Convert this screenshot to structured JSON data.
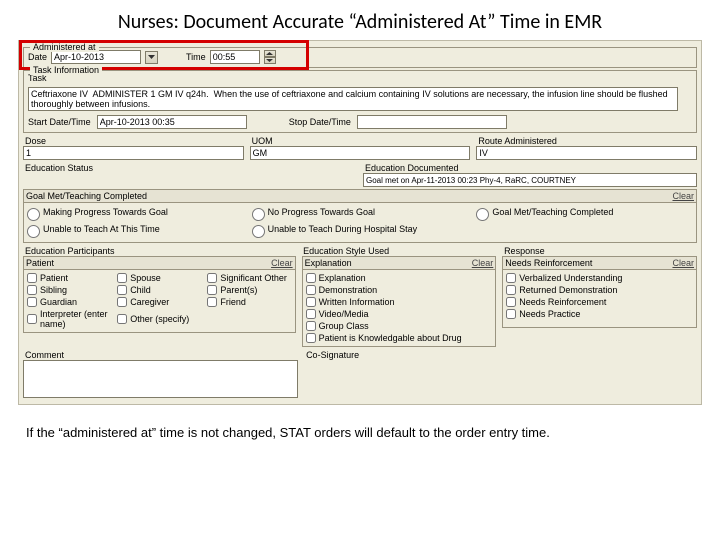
{
  "title": "Nurses: Document Accurate “Administered At” Time in EMR",
  "administered": {
    "section": "Administered at",
    "dateLabel": "Date",
    "dateValue": "Apr-10-2013",
    "timeLabel": "Time",
    "timeValue": "00:55"
  },
  "task": {
    "section": "Task Information",
    "label": "Task",
    "value": "Ceftriaxone IV  ADMINISTER 1 GM IV q24h.  When the use of ceftriaxone and calcium containing IV solutions are necessary, the infusion line should be flushed thoroughly between infusions.",
    "startLabel": "Start Date/Time",
    "startValue": "Apr-10-2013 00:35",
    "stopLabel": "Stop Date/Time",
    "stopValue": ""
  },
  "dose": {
    "label": "Dose",
    "value": "1"
  },
  "uom": {
    "label": "UOM",
    "value": "GM"
  },
  "route": {
    "label": "Route Administered",
    "value": "IV"
  },
  "eduStatus": {
    "label": "Education Status"
  },
  "eduDoc": {
    "label": "Education Documented",
    "value": "Goal met on Apr-11-2013 00:23 Phy-4, RaRC, COURTNEY"
  },
  "goalMet": {
    "header": "Goal Met/Teaching Completed",
    "clear": "Clear",
    "opts": [
      "Making Progress Towards Goal",
      "No Progress Towards Goal",
      "Goal Met/Teaching Completed",
      "Unable to Teach At This Time",
      "Unable to Teach During Hospital Stay"
    ]
  },
  "participants": {
    "label": "Education Participants",
    "header": "Patient",
    "clear": "Clear",
    "items": [
      "Patient",
      "Spouse",
      "Significant Other",
      "Sibling",
      "Child",
      "Parent(s)",
      "Guardian",
      "Caregiver",
      "Friend",
      "Interpreter (enter name)",
      "Other (specify)"
    ]
  },
  "style": {
    "label": "Education Style Used",
    "header": "Explanation",
    "clear": "Clear",
    "items": [
      "Explanation",
      "Demonstration",
      "Written Information",
      "Video/Media",
      "Group Class",
      "Patient is Knowledgable about Drug"
    ]
  },
  "response": {
    "label": "Response",
    "header": "Needs Reinforcement",
    "clear": "Clear",
    "items": [
      "Verbalized Understanding",
      "Returned Demonstration",
      "Needs Reinforcement",
      "Needs Practice"
    ]
  },
  "comment": {
    "label": "Comment"
  },
  "cosig": {
    "label": "Co-Signature"
  },
  "footer": "If the “administered at” time is not changed, STAT orders will default to the order entry time."
}
